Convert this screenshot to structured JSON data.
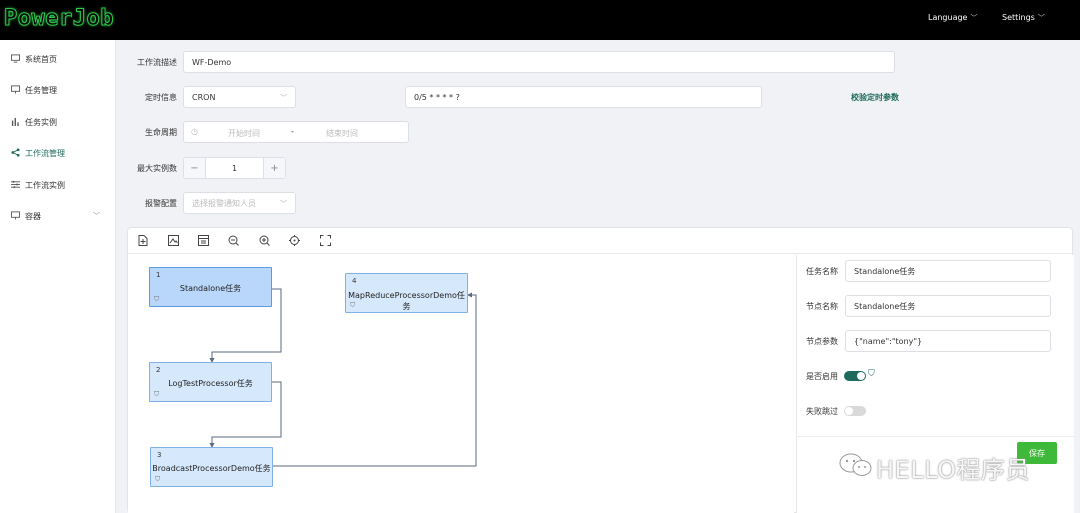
{
  "app": {
    "logo": "PowerJob"
  },
  "topbar": {
    "language": "Language",
    "settings": "Settings"
  },
  "sidebar": {
    "items": [
      {
        "label": "系统首页",
        "icon": "monitor-icon"
      },
      {
        "label": "任务管理",
        "icon": "task-icon"
      },
      {
        "label": "任务实例",
        "icon": "bar-chart-icon"
      },
      {
        "label": "工作流管理",
        "icon": "share-icon",
        "active": true
      },
      {
        "label": "工作流实例",
        "icon": "sliders-icon"
      },
      {
        "label": "容器",
        "icon": "container-icon"
      }
    ]
  },
  "form": {
    "desc_label": "工作流描述",
    "desc_value": "WF-Demo",
    "timing_label": "定时信息",
    "timing_type": "CRON",
    "timing_expr": "0/5 * * * * ?",
    "validate_link": "校验定时参数",
    "lifecycle_label": "生命周期",
    "start_placeholder": "开始时间",
    "range_sep": "-",
    "end_placeholder": "结束时间",
    "max_instances_label": "最大实例数",
    "max_instances_value": "1",
    "alarm_label": "报警配置",
    "alarm_placeholder": "选择报警通知人员"
  },
  "workflow": {
    "nodes": [
      {
        "id": "1",
        "label": "Standalone任务",
        "selected": true
      },
      {
        "id": "2",
        "label": "LogTestProcessor任务"
      },
      {
        "id": "3",
        "label": "BroadcastProcessorDemo任务"
      },
      {
        "id": "4",
        "label": "MapReduceProcessorDemo任务"
      }
    ]
  },
  "panel": {
    "task_name_label": "任务名称",
    "task_name_value": "Standalone任务",
    "node_name_label": "节点名称",
    "node_name_value": "Standalone任务",
    "node_params_label": "节点参数",
    "node_params_value": "{\"name\":\"tony\"}",
    "enabled_label": "是否启用",
    "enabled": true,
    "skip_label": "失败跳过",
    "skip": false,
    "save_label": "保存"
  },
  "watermark": "HELLO程序员",
  "colors": {
    "accent": "#1e6b5c",
    "node_fill": "#d6e8fc",
    "node_border": "#7fb0e6",
    "save": "#3fb93a"
  }
}
